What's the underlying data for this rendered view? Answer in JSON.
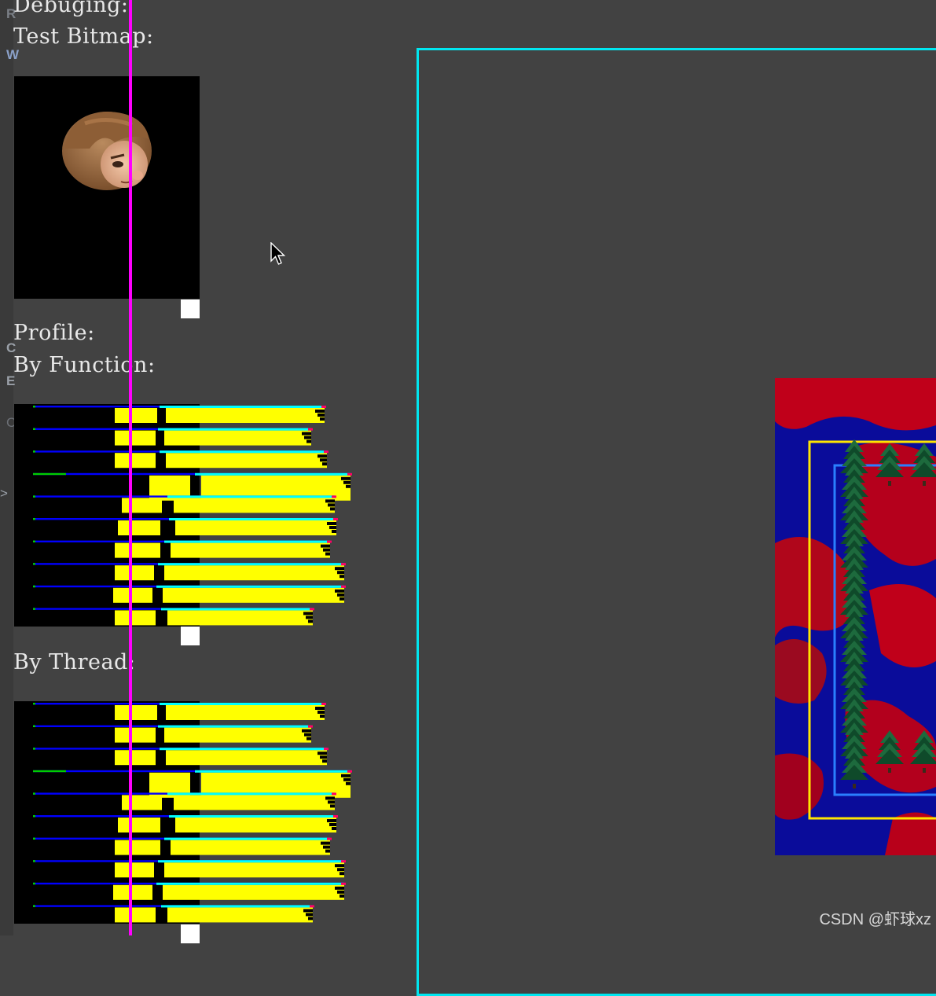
{
  "debug_panel": {
    "header": "Debuging:",
    "test_bitmap_label": "Test Bitmap:",
    "profile_label": "Profile:",
    "by_function_label": "By Function:",
    "by_thread_label": "By Thread:"
  },
  "colors": {
    "background": "#424242",
    "marker_line": "#ff00ff",
    "world_frame": "#00e6f0",
    "bar_fill": "#ffff00",
    "bar_top": "#00ffff",
    "bar_thread": "#0000ff",
    "bar_start": "#00cc00",
    "bar_tail": "#ff0066",
    "camera_outer": "#ffe600",
    "camera_inner": "#2a7fff"
  },
  "icons": {
    "cursor": "mouse-pointer-icon",
    "portrait": "hero-head-sprite"
  },
  "watermark": "CSDN @虾球xz",
  "side_strip_glyphs": [
    "R",
    "W",
    "C",
    "E",
    "C",
    ">"
  ]
}
